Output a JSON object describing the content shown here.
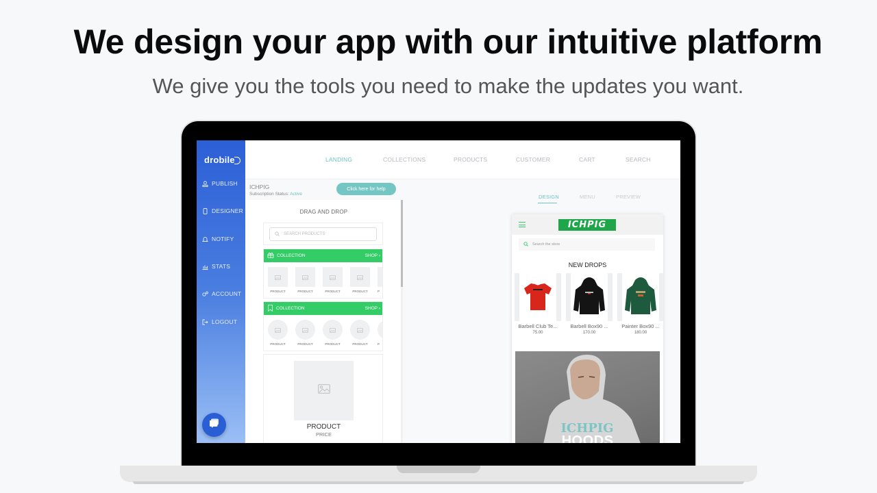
{
  "hero": {
    "title": "We design your app with our intuitive platform",
    "subtitle": "We give you the tools you need to make the updates you want."
  },
  "app": {
    "logo": "drobile",
    "sidebar": {
      "items": [
        {
          "label": "PUBLISH",
          "icon": "publish-icon"
        },
        {
          "label": "DESIGNER",
          "icon": "phone-icon"
        },
        {
          "label": "NOTIFY",
          "icon": "bell-icon"
        },
        {
          "label": "STATS",
          "icon": "bar-chart-icon"
        },
        {
          "label": "ACCOUNT",
          "icon": "gears-icon"
        },
        {
          "label": "LOGOUT",
          "icon": "logout-icon"
        }
      ],
      "chat_icon": "chat-bubble-icon"
    },
    "topnav": {
      "items": [
        "LANDING",
        "COLLECTIONS",
        "PRODUCTS",
        "CUSTOMER",
        "CART",
        "SEARCH"
      ],
      "active": "LANDING"
    },
    "store": {
      "name": "ICHPIG",
      "status_label": "Subscription Status:",
      "status_value": "Active",
      "help_button": "Click here for help"
    },
    "dnd": {
      "title": "DRAG AND DROP",
      "search_placeholder": "SEARCH PRODUCTS",
      "collections": [
        {
          "label": "COLLECTION",
          "shop": "SHOP",
          "icon": "gift-icon",
          "style": "square",
          "products": [
            "PRODUCT",
            "PRODUCT",
            "PRODUCT",
            "PRODUCT",
            "P"
          ]
        },
        {
          "label": "COLLECTION",
          "shop": "SHOP",
          "icon": "bookmark-icon",
          "style": "round",
          "products": [
            "PRODUCT",
            "PRODUCT",
            "PRODUCT",
            "PRODUCT",
            "P"
          ]
        }
      ],
      "product_card": {
        "name": "PRODUCT",
        "price": "PRICE"
      }
    },
    "preview_tabs": {
      "items": [
        "DESIGN",
        "MENU",
        "PREVIEW"
      ],
      "active": "DESIGN"
    },
    "phone": {
      "brand": "ICHPIG",
      "search_placeholder": "Search the store",
      "section_title": "NEW DROPS",
      "items": [
        {
          "name": "Barbell Club Te...",
          "price": "75.00",
          "color": "#d9261c"
        },
        {
          "name": "Barbell Box90 ...",
          "price": "170.00",
          "color": "#141414"
        },
        {
          "name": "Painter Box90 ...",
          "price": "180.00",
          "color": "#1d5a3e"
        }
      ],
      "banner_text": "HOODS"
    }
  }
}
